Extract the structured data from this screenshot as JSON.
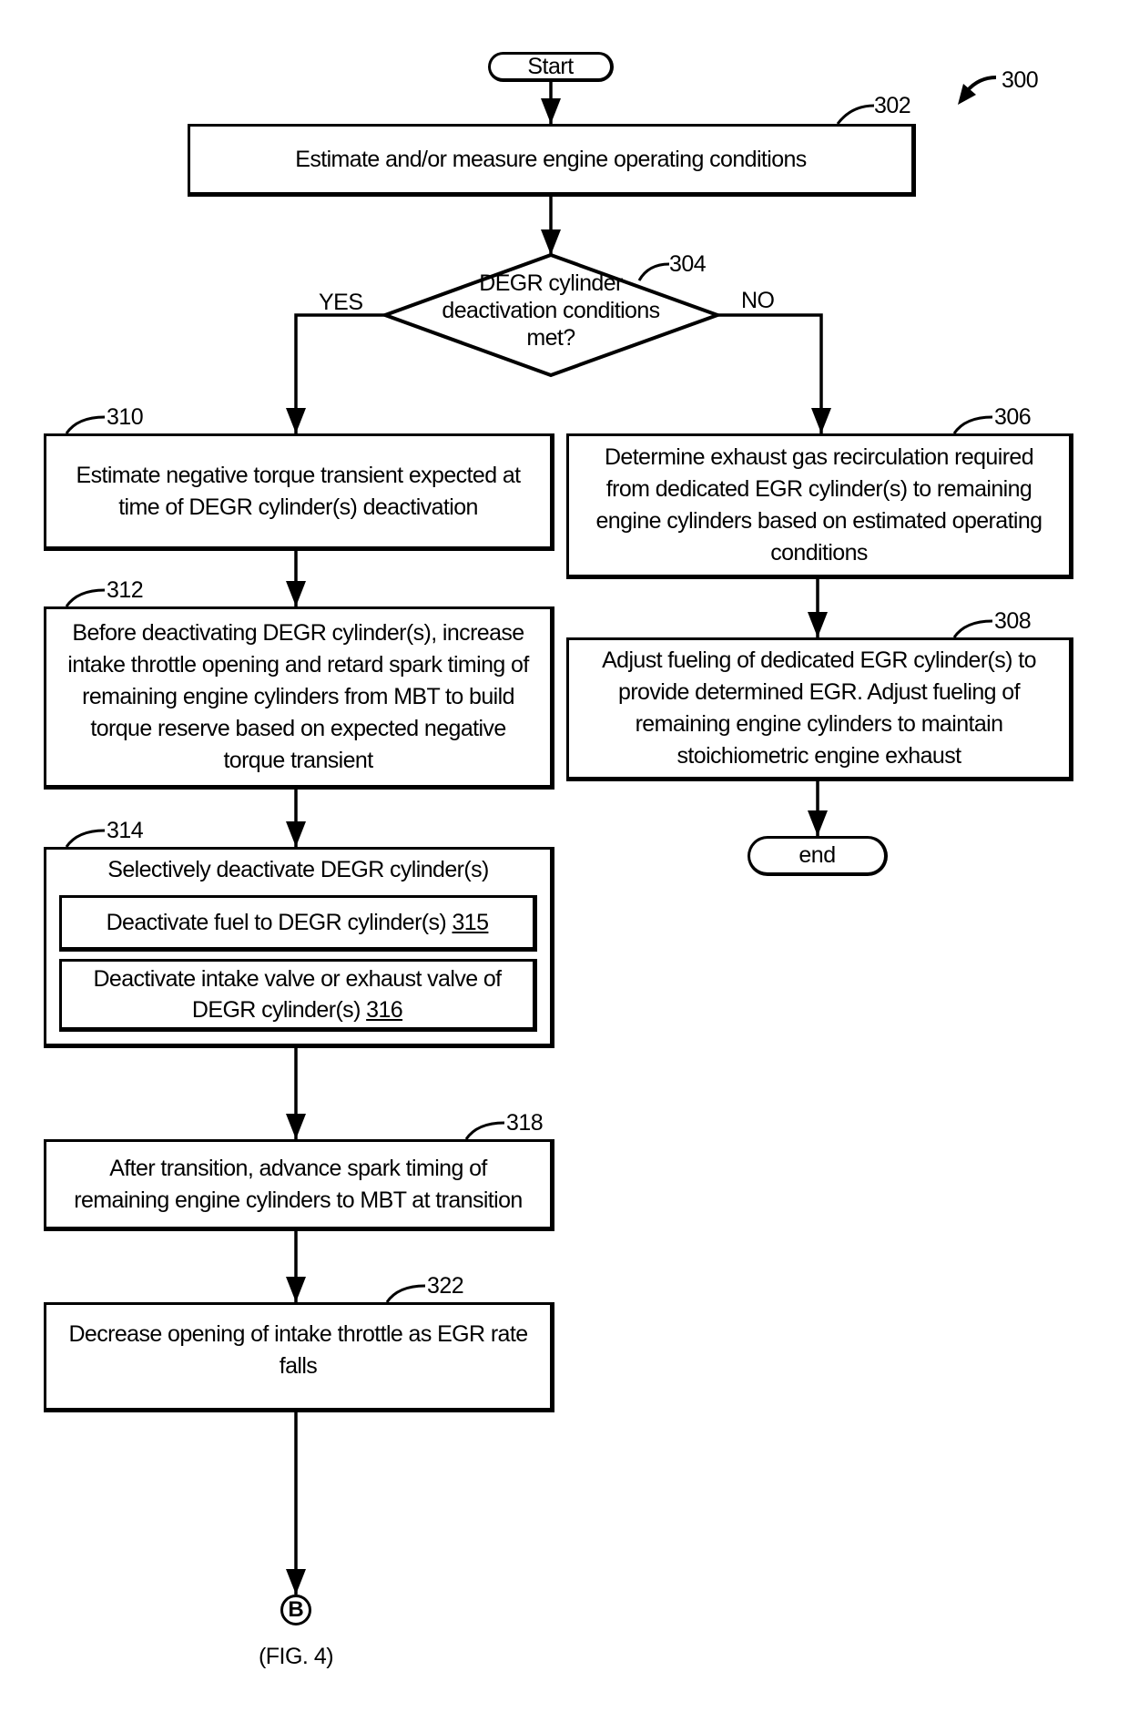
{
  "figure": {
    "number": "300",
    "connector_label": "B",
    "connector_ref": "(FIG. 4)"
  },
  "start": {
    "label": "Start"
  },
  "end": {
    "label": "end"
  },
  "steps": {
    "s302": {
      "ref": "302",
      "text": "Estimate and/or measure engine operating conditions"
    },
    "s304": {
      "ref": "304",
      "lines": [
        "DEGR cylinder",
        "deactivation conditions",
        "met?"
      ],
      "yes_label": "YES",
      "no_label": "NO"
    },
    "s306": {
      "ref": "306",
      "lines": [
        "Determine exhaust gas recirculation required",
        "from dedicated EGR cylinder(s) to remaining",
        "engine cylinders based on estimated operating",
        "conditions"
      ]
    },
    "s308": {
      "ref": "308",
      "lines": [
        "Adjust fueling of dedicated EGR cylinder(s) to",
        "provide determined EGR. Adjust fueling of",
        "remaining engine cylinders to maintain",
        "stoichiometric engine exhaust"
      ]
    },
    "s310": {
      "ref": "310",
      "lines": [
        "Estimate negative torque transient expected at",
        "time of DEGR cylinder(s) deactivation"
      ]
    },
    "s312": {
      "ref": "312",
      "lines": [
        "Before deactivating DEGR cylinder(s), increase",
        "intake throttle opening and retard spark timing of",
        "remaining engine cylinders from MBT to build",
        "torque reserve based on expected negative",
        "torque transient"
      ]
    },
    "s314": {
      "ref": "314",
      "title": "Selectively deactivate DEGR cylinder(s)",
      "sub315": {
        "text": "Deactivate fuel to DEGR cylinder(s) ",
        "ref": "315"
      },
      "sub316": {
        "line1": "Deactivate intake valve or exhaust valve of",
        "line2": "DEGR cylinder(s) ",
        "ref": "316"
      }
    },
    "s318": {
      "ref": "318",
      "lines": [
        "After transition, advance spark timing of",
        "remaining engine cylinders to MBT at transition"
      ]
    },
    "s322": {
      "ref": "322",
      "lines": [
        "Decrease opening of intake throttle as EGR rate",
        "falls"
      ]
    }
  }
}
